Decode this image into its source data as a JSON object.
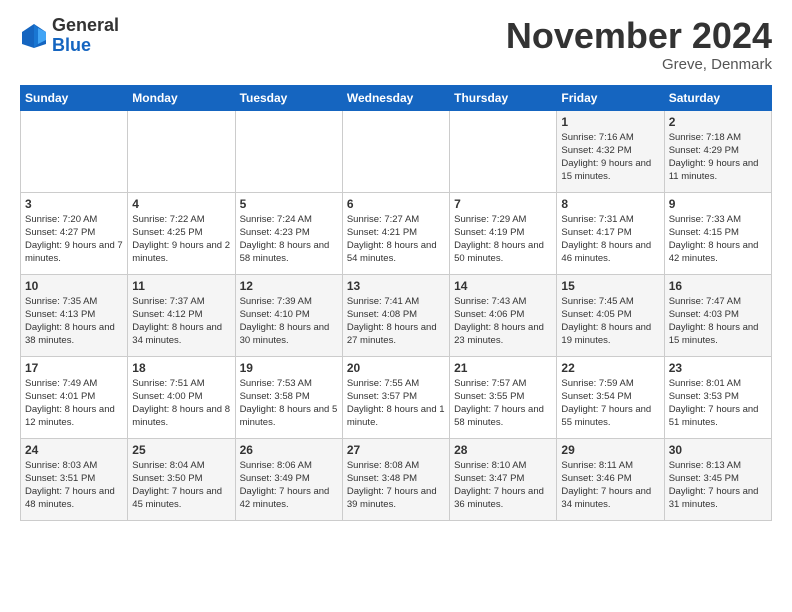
{
  "logo": {
    "general": "General",
    "blue": "Blue"
  },
  "title": "November 2024",
  "location": "Greve, Denmark",
  "days_of_week": [
    "Sunday",
    "Monday",
    "Tuesday",
    "Wednesday",
    "Thursday",
    "Friday",
    "Saturday"
  ],
  "weeks": [
    [
      {
        "day": "",
        "info": ""
      },
      {
        "day": "",
        "info": ""
      },
      {
        "day": "",
        "info": ""
      },
      {
        "day": "",
        "info": ""
      },
      {
        "day": "",
        "info": ""
      },
      {
        "day": "1",
        "info": "Sunrise: 7:16 AM\nSunset: 4:32 PM\nDaylight: 9 hours and 15 minutes."
      },
      {
        "day": "2",
        "info": "Sunrise: 7:18 AM\nSunset: 4:29 PM\nDaylight: 9 hours and 11 minutes."
      }
    ],
    [
      {
        "day": "3",
        "info": "Sunrise: 7:20 AM\nSunset: 4:27 PM\nDaylight: 9 hours and 7 minutes."
      },
      {
        "day": "4",
        "info": "Sunrise: 7:22 AM\nSunset: 4:25 PM\nDaylight: 9 hours and 2 minutes."
      },
      {
        "day": "5",
        "info": "Sunrise: 7:24 AM\nSunset: 4:23 PM\nDaylight: 8 hours and 58 minutes."
      },
      {
        "day": "6",
        "info": "Sunrise: 7:27 AM\nSunset: 4:21 PM\nDaylight: 8 hours and 54 minutes."
      },
      {
        "day": "7",
        "info": "Sunrise: 7:29 AM\nSunset: 4:19 PM\nDaylight: 8 hours and 50 minutes."
      },
      {
        "day": "8",
        "info": "Sunrise: 7:31 AM\nSunset: 4:17 PM\nDaylight: 8 hours and 46 minutes."
      },
      {
        "day": "9",
        "info": "Sunrise: 7:33 AM\nSunset: 4:15 PM\nDaylight: 8 hours and 42 minutes."
      }
    ],
    [
      {
        "day": "10",
        "info": "Sunrise: 7:35 AM\nSunset: 4:13 PM\nDaylight: 8 hours and 38 minutes."
      },
      {
        "day": "11",
        "info": "Sunrise: 7:37 AM\nSunset: 4:12 PM\nDaylight: 8 hours and 34 minutes."
      },
      {
        "day": "12",
        "info": "Sunrise: 7:39 AM\nSunset: 4:10 PM\nDaylight: 8 hours and 30 minutes."
      },
      {
        "day": "13",
        "info": "Sunrise: 7:41 AM\nSunset: 4:08 PM\nDaylight: 8 hours and 27 minutes."
      },
      {
        "day": "14",
        "info": "Sunrise: 7:43 AM\nSunset: 4:06 PM\nDaylight: 8 hours and 23 minutes."
      },
      {
        "day": "15",
        "info": "Sunrise: 7:45 AM\nSunset: 4:05 PM\nDaylight: 8 hours and 19 minutes."
      },
      {
        "day": "16",
        "info": "Sunrise: 7:47 AM\nSunset: 4:03 PM\nDaylight: 8 hours and 15 minutes."
      }
    ],
    [
      {
        "day": "17",
        "info": "Sunrise: 7:49 AM\nSunset: 4:01 PM\nDaylight: 8 hours and 12 minutes."
      },
      {
        "day": "18",
        "info": "Sunrise: 7:51 AM\nSunset: 4:00 PM\nDaylight: 8 hours and 8 minutes."
      },
      {
        "day": "19",
        "info": "Sunrise: 7:53 AM\nSunset: 3:58 PM\nDaylight: 8 hours and 5 minutes."
      },
      {
        "day": "20",
        "info": "Sunrise: 7:55 AM\nSunset: 3:57 PM\nDaylight: 8 hours and 1 minute."
      },
      {
        "day": "21",
        "info": "Sunrise: 7:57 AM\nSunset: 3:55 PM\nDaylight: 7 hours and 58 minutes."
      },
      {
        "day": "22",
        "info": "Sunrise: 7:59 AM\nSunset: 3:54 PM\nDaylight: 7 hours and 55 minutes."
      },
      {
        "day": "23",
        "info": "Sunrise: 8:01 AM\nSunset: 3:53 PM\nDaylight: 7 hours and 51 minutes."
      }
    ],
    [
      {
        "day": "24",
        "info": "Sunrise: 8:03 AM\nSunset: 3:51 PM\nDaylight: 7 hours and 48 minutes."
      },
      {
        "day": "25",
        "info": "Sunrise: 8:04 AM\nSunset: 3:50 PM\nDaylight: 7 hours and 45 minutes."
      },
      {
        "day": "26",
        "info": "Sunrise: 8:06 AM\nSunset: 3:49 PM\nDaylight: 7 hours and 42 minutes."
      },
      {
        "day": "27",
        "info": "Sunrise: 8:08 AM\nSunset: 3:48 PM\nDaylight: 7 hours and 39 minutes."
      },
      {
        "day": "28",
        "info": "Sunrise: 8:10 AM\nSunset: 3:47 PM\nDaylight: 7 hours and 36 minutes."
      },
      {
        "day": "29",
        "info": "Sunrise: 8:11 AM\nSunset: 3:46 PM\nDaylight: 7 hours and 34 minutes."
      },
      {
        "day": "30",
        "info": "Sunrise: 8:13 AM\nSunset: 3:45 PM\nDaylight: 7 hours and 31 minutes."
      }
    ]
  ]
}
